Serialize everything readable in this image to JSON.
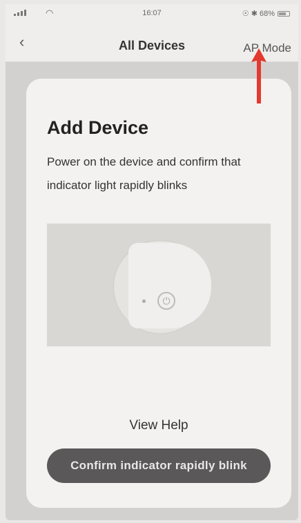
{
  "status_bar": {
    "time": "16:07",
    "battery_text": "☉ ✱ 68%"
  },
  "nav": {
    "back_glyph": "‹",
    "title": "All Devices",
    "ap_mode_label": "AP Mode"
  },
  "card": {
    "title": "Add Device",
    "description": "Power on the device and confirm that indicator light rapidly blinks",
    "view_help_label": "View Help",
    "confirm_button_label": "Confirm indicator rapidly blink"
  },
  "icons": {
    "power": "⏻",
    "wifi": "◠"
  },
  "colors": {
    "button_bg": "#5a5858",
    "annotation_arrow": "#e23a2f"
  }
}
